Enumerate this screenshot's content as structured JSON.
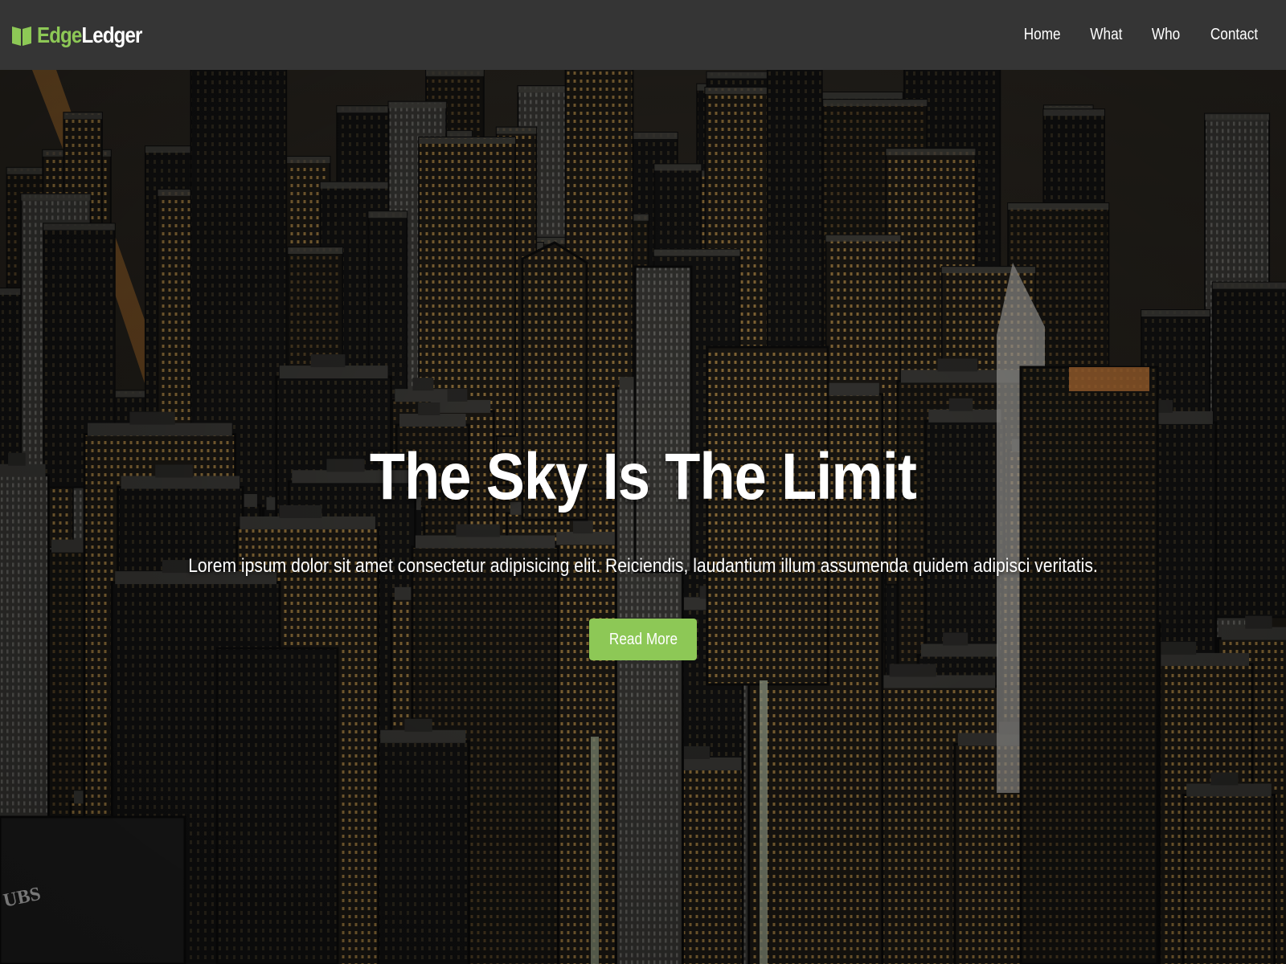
{
  "brand": {
    "name_part1": "Edge",
    "name_part2": "Ledger",
    "icon": "open-book-icon",
    "accent_color": "#8dc856"
  },
  "nav": {
    "items": [
      {
        "label": "Home"
      },
      {
        "label": "What"
      },
      {
        "label": "Who"
      },
      {
        "label": "Contact"
      }
    ]
  },
  "hero": {
    "title": "The Sky Is The Limit",
    "text": "Lorem ipsum dolor sit amet consectetur adipisicing elit. Reiciendis, laudantium illum assumenda quidem adipisci veritatis.",
    "button_label": "Read More",
    "background": "night city skyline aerial photo",
    "sign_text": "UBS"
  },
  "colors": {
    "navbar_bg": "#353535",
    "button_bg": "#8dc856"
  }
}
